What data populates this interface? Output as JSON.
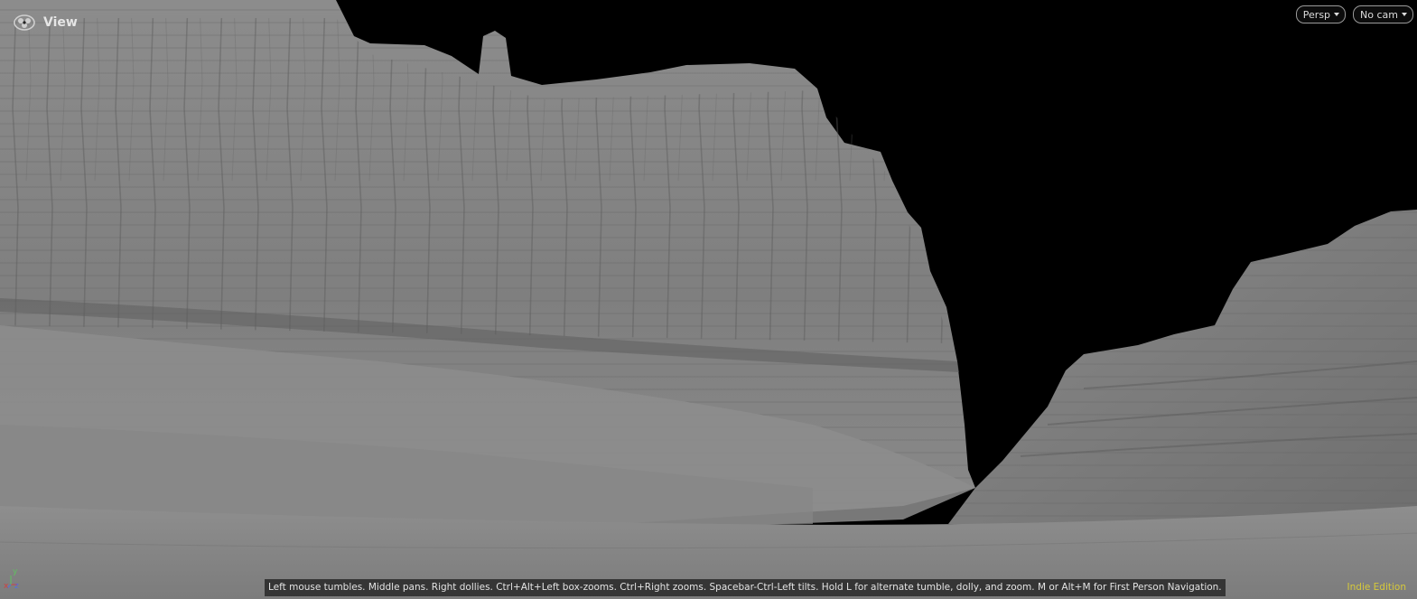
{
  "viewport": {
    "title": "View",
    "view_icon": "houdini-view-icon",
    "projection_button": {
      "label": "Persp",
      "icon": "chevron-down-icon"
    },
    "camera_button": {
      "label": "No cam",
      "icon": "chevron-down-icon"
    },
    "navigation_hint": "Left mouse tumbles. Middle pans. Right dollies. Ctrl+Alt+Left box-zooms. Ctrl+Right zooms. Spacebar-Ctrl-Left tilts. Hold L for alternate tumble, dolly, and zoom. M or Alt+M for First Person Navigation.",
    "edition_label": "Indie Edition",
    "axis_gizmo": {
      "x": "x",
      "y": "y",
      "z": "z"
    }
  },
  "colors": {
    "background": "#000000",
    "terrain": "#8a8a8a",
    "edition_text": "#d6c93a",
    "axis_x": "#d04040",
    "axis_y": "#60c060",
    "axis_z": "#5070e0"
  }
}
